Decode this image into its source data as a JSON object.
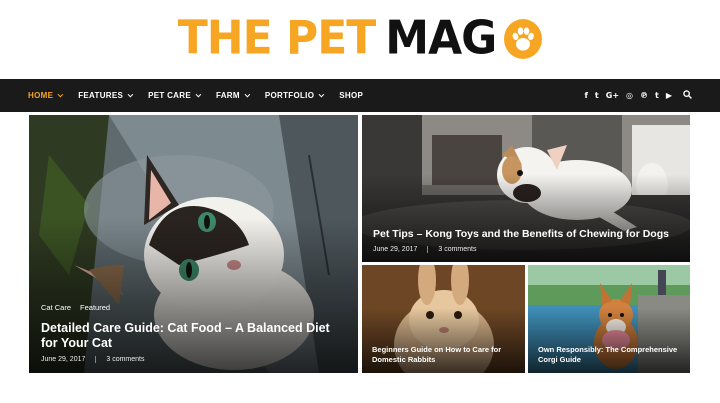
{
  "logo": {
    "word1": "THE PET",
    "word2": "MAG",
    "icon": "paw-icon"
  },
  "nav": {
    "items": [
      {
        "label": "HOME",
        "active": true,
        "dropdown": true
      },
      {
        "label": "FEATURES",
        "dropdown": true
      },
      {
        "label": "PET CARE",
        "dropdown": true
      },
      {
        "label": "FARM",
        "dropdown": true
      },
      {
        "label": "PORTFOLIO",
        "dropdown": true
      },
      {
        "label": "SHOP",
        "dropdown": false
      }
    ],
    "social": [
      {
        "icon": "facebook-icon",
        "glyph": "f"
      },
      {
        "icon": "twitter-icon",
        "glyph": "t"
      },
      {
        "icon": "google-plus-icon",
        "glyph": "G+"
      },
      {
        "icon": "instagram-icon",
        "glyph": "◎"
      },
      {
        "icon": "pinterest-icon",
        "glyph": "℗"
      },
      {
        "icon": "tumblr-icon",
        "glyph": "t"
      },
      {
        "icon": "youtube-icon",
        "glyph": "▶"
      }
    ],
    "search_icon": "search-icon"
  },
  "posts": {
    "featured": {
      "categories": [
        "Cat Care",
        "Featured"
      ],
      "title": "Detailed Care Guide: Cat Food – A Balanced Diet for Your Cat",
      "date": "June 29, 2017",
      "comments": "3 comments"
    },
    "top_right": {
      "title": "Pet Tips – Kong Toys and the Benefits of Chewing for Dogs",
      "date": "June 29, 2017",
      "comments": "3 comments"
    },
    "bottom_left": {
      "title": "Beginners Guide on How to Care for Domestic Rabbits"
    },
    "bottom_right": {
      "title": "Own Responsibly: The Comprehensive Corgi Guide"
    }
  },
  "colors": {
    "accent": "#f6a623",
    "nav_bg": "#1a1a1a",
    "text": "#111111"
  }
}
